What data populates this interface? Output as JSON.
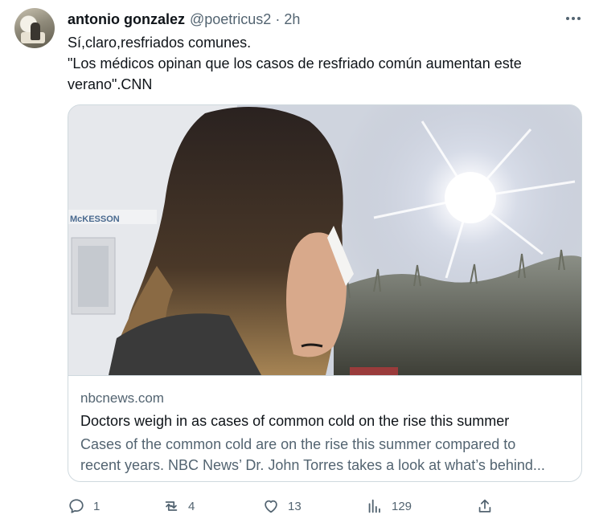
{
  "author": {
    "name": "antonio gonzalez",
    "handle": "@poetricus2",
    "separator": "·",
    "time": "2h"
  },
  "tweet": {
    "lines": [
      "Sí,claro,resfriados comunes.",
      "\"Los médicos opinan que los casos de resfriado común aumentan este",
      "verano\".CNN"
    ]
  },
  "card": {
    "image_sign_text": "McKESSON",
    "domain": "nbcnews.com",
    "title": "Doctors weigh in as cases of common cold on the rise this summer",
    "description_lines": [
      "Cases of the common cold are on the rise this summer compared to",
      "recent years. NBC News’ Dr. John Torres takes a look at what’s behind..."
    ]
  },
  "actions": {
    "replies": "1",
    "reposts": "4",
    "likes": "13",
    "views": "129"
  },
  "icons": {
    "more": "more-horizontal-icon",
    "reply": "reply-icon",
    "repost": "repost-icon",
    "like": "heart-icon",
    "views": "views-chart-icon",
    "share": "share-icon"
  },
  "colors": {
    "text_primary": "#0f1419",
    "text_secondary": "#536471",
    "border": "#cfd9de"
  }
}
